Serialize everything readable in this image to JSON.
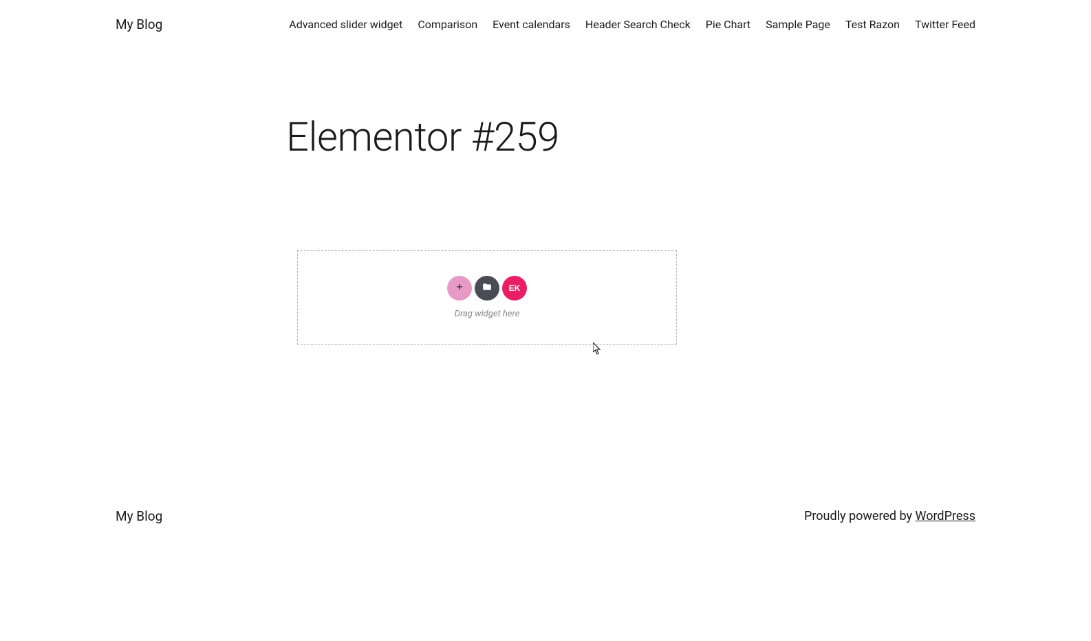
{
  "header": {
    "site_title": "My Blog",
    "nav": [
      "Advanced slider widget",
      "Comparison",
      "Event calendars",
      "Header Search Check",
      "Pie Chart",
      "Sample Page",
      "Test Razon",
      "Twitter Feed"
    ]
  },
  "page": {
    "title": "Elementor #259"
  },
  "editor": {
    "drag_hint": "Drag widget here",
    "btn_ek_label": "EK"
  },
  "footer": {
    "site_title": "My Blog",
    "powered_text": "Proudly powered by ",
    "powered_link": "WordPress"
  }
}
